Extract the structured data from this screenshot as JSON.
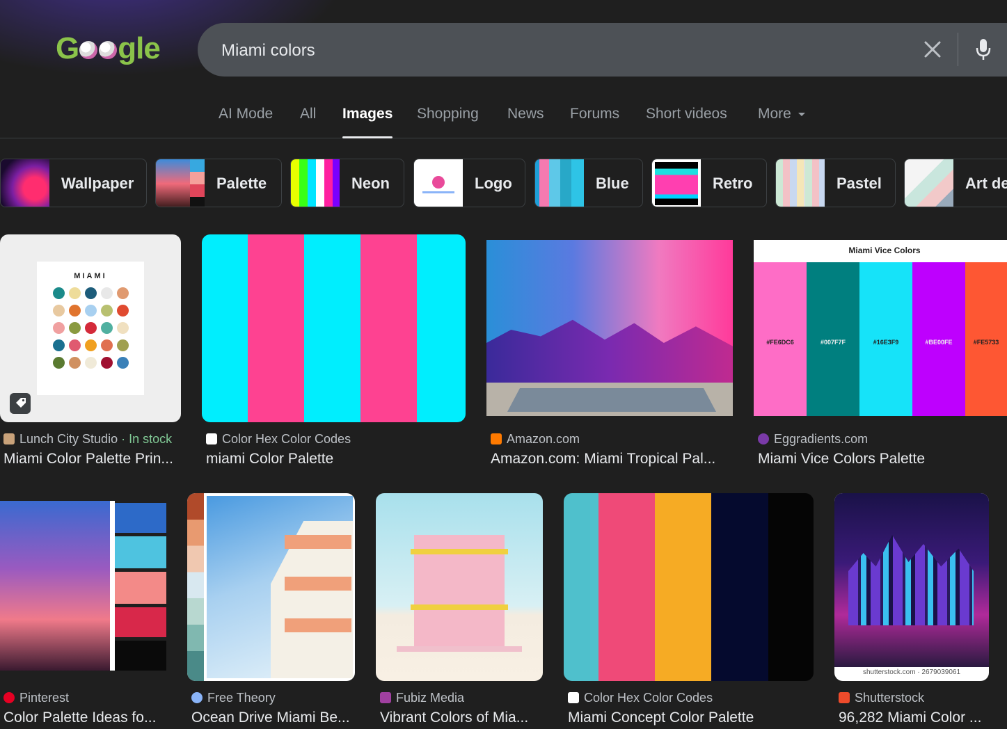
{
  "logo": "Google",
  "search": {
    "value": "Miami colors"
  },
  "tabs": [
    "AI Mode",
    "All",
    "Images",
    "Shopping",
    "News",
    "Forums",
    "Short videos",
    "More"
  ],
  "active_tab": "Images",
  "chips": [
    "Wallpaper",
    "Palette",
    "Neon",
    "Logo",
    "Blue",
    "Retro",
    "Pastel",
    "Art de"
  ],
  "results_row1": [
    {
      "source": "Lunch City Studio",
      "stock": " · In stock",
      "title": "Miami Color Palette Prin...",
      "poster_title": "MIAMI"
    },
    {
      "source": "Color Hex Color Codes",
      "title": "miami Color Palette"
    },
    {
      "source": "Amazon.com",
      "title": "Amazon.com: Miami Tropical Pal..."
    },
    {
      "source": "Eggradients.com",
      "title": "Miami Vice Colors Palette",
      "poster_title": "Miami Vice Colors",
      "hex": [
        "#FE6DC6",
        "#007F7F",
        "#16E3F9",
        "#BE00FE",
        "#FE5733"
      ]
    }
  ],
  "results_row2": [
    {
      "source": "Pinterest",
      "title": "Color Palette Ideas fo..."
    },
    {
      "source": "Free Theory",
      "title": "Ocean Drive Miami Be..."
    },
    {
      "source": "Fubiz Media",
      "title": "Vibrant Colors of Mia..."
    },
    {
      "source": "Color Hex Color Codes",
      "title": "Miami Concept Color Palette"
    },
    {
      "source": "Shutterstock",
      "title": "96,282 Miami Color ...",
      "watermark": "shutterstock.com · 2679039061"
    }
  ],
  "colors": {
    "background": "#1f1f1f",
    "search_bg": "#4d5156",
    "in_stock": "#81c995"
  }
}
